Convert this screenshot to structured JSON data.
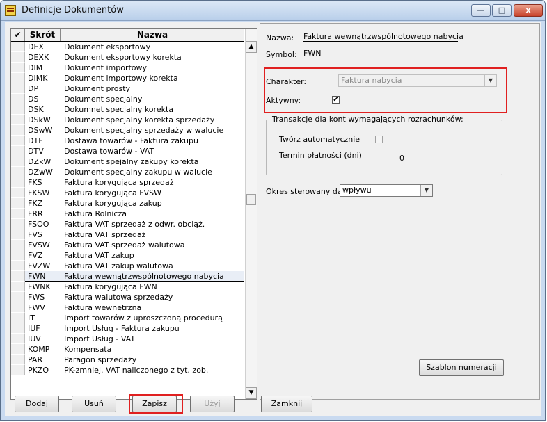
{
  "window": {
    "title": "Definicje Dokumentów",
    "buttons": {
      "minimize": "—",
      "maximize": "□",
      "close": "x"
    }
  },
  "list": {
    "columns": {
      "check": "✔",
      "code": "Skrót",
      "name": "Nazwa"
    },
    "selected_index": 23,
    "rows": [
      {
        "code": "DEX",
        "name": "Dokument eksportowy"
      },
      {
        "code": "DEXK",
        "name": "Dokument eksportowy korekta"
      },
      {
        "code": "DIM",
        "name": "Dokument importowy"
      },
      {
        "code": "DIMK",
        "name": "Dokument importowy korekta"
      },
      {
        "code": "DP",
        "name": "Dokument prosty"
      },
      {
        "code": "DS",
        "name": "Dokument specjalny"
      },
      {
        "code": "DSK",
        "name": "Dokumnet specjalny korekta"
      },
      {
        "code": "DSkW",
        "name": "Dokument specjalny korekta sprzedaży"
      },
      {
        "code": "DSwW",
        "name": "Dokument specjalny sprzedaży w walucie"
      },
      {
        "code": "DTF",
        "name": "Dostawa towarów - Faktura zakupu"
      },
      {
        "code": "DTV",
        "name": "Dostawa towarów - VAT"
      },
      {
        "code": "DZkW",
        "name": "Dokument spejalny zakupy korekta"
      },
      {
        "code": "DZwW",
        "name": "Dokument specjalny zakupu w walucie"
      },
      {
        "code": "FKS",
        "name": "Faktura korygująca sprzedaż"
      },
      {
        "code": "FKSW",
        "name": "Faktura korygująca FVSW"
      },
      {
        "code": "FKZ",
        "name": "Faktura korygująca zakup"
      },
      {
        "code": "FRR",
        "name": "Faktura Rolnicza"
      },
      {
        "code": "FSOO",
        "name": "Faktura VAT sprzedaż z odwr. obciąż."
      },
      {
        "code": "FVS",
        "name": "Faktura VAT sprzedaż"
      },
      {
        "code": "FVSW",
        "name": "Faktura VAT sprzedaż walutowa"
      },
      {
        "code": "FVZ",
        "name": "Faktura VAT zakup"
      },
      {
        "code": "FVZW",
        "name": "Faktura VAT zakup walutowa"
      },
      {
        "code": "FWN",
        "name": "Faktura wewnątrzwspólnotowego nabycia"
      },
      {
        "code": "FWNK",
        "name": "Faktura korygująca FWN"
      },
      {
        "code": "FWS",
        "name": "Faktura walutowa sprzedaży"
      },
      {
        "code": "FWV",
        "name": "Faktura wewnętrzna"
      },
      {
        "code": "IT",
        "name": "Import towarów z uproszczoną procedurą"
      },
      {
        "code": "IUF",
        "name": "Import Usług - Faktura zakupu"
      },
      {
        "code": "IUV",
        "name": "Import Usług - VAT"
      },
      {
        "code": "KOMP",
        "name": "Kompensata"
      },
      {
        "code": "PAR",
        "name": "Paragon sprzedaży"
      },
      {
        "code": "PKZO",
        "name": "PK-zmniej. VAT naliczonego z tyt. zob."
      }
    ]
  },
  "detail": {
    "nazwa_label": "Nazwa:",
    "nazwa_value": "Faktura wewnątrzwspólnotowego nabycia",
    "symbol_label": "Symbol:",
    "symbol_value": "FWN",
    "charakter_label": "Charakter:",
    "charakter_value": "Faktura nabycia",
    "aktywny_label": "Aktywny:",
    "aktywny_checked": "✔",
    "group_title": "Transakcje dla kont wymagających rozrachunków:",
    "tworz_label": "Twórz automatycznie",
    "termin_label": "Termin płatności (dni)",
    "termin_value": "0",
    "okres_label": "Okres sterowany datą:",
    "okres_value": "wpływu",
    "szablon_button": "Szablon numeracji"
  },
  "buttons": {
    "dodaj": "Dodaj",
    "usun": "Usuń",
    "zapisz": "Zapisz",
    "uzyj": "Użyj",
    "zamknij": "Zamknij"
  },
  "colors": {
    "highlight": "#e02020",
    "selected_row": "#e9eef6"
  }
}
